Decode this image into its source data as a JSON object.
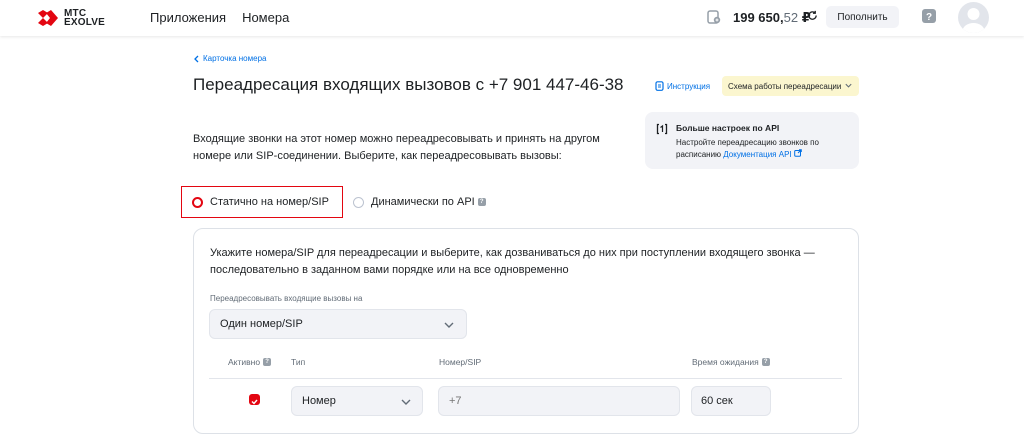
{
  "header": {
    "logo_line1": "МТС",
    "logo_line2": "EXOLVE",
    "nav": [
      "Приложения",
      "Номера"
    ],
    "balance_main": "199 650,",
    "balance_cents": "52",
    "currency": "₽",
    "topup_label": "Пополнить"
  },
  "breadcrumb": "Карточка номера",
  "title": "Переадресация входящих вызовов с +7 901 447-46-38",
  "instruction_link": "Инструкция",
  "scheme_button": "Схема работы переадресации",
  "description": "Входящие звонки на этот номер можно переадресовывать и принять на другом номере или SIP-соединении. Выберите, как переадресовывать вызовы:",
  "api_card": {
    "title": "Больше настроек по API",
    "text": "Настройте переадресацию звонков по расписанию",
    "link": "Документация API"
  },
  "modes": {
    "static": "Статично на номер/SIP",
    "dynamic": "Динамически по API"
  },
  "panel": {
    "description": "Укажите номера/SIP для переадресации и выберите, как дозваниваться до них при поступлении входящего звонка — последовательно в заданном вами порядке или на все одновременно",
    "forward_label": "Переадресовывать входящие вызовы на",
    "forward_value": "Один номер/SIP",
    "columns": {
      "active": "Активно",
      "type": "Тип",
      "number": "Номер/SIP",
      "wait": "Время ожидания"
    },
    "row": {
      "active": true,
      "type": "Номер",
      "number_placeholder": "+7",
      "wait": "60 сек"
    }
  },
  "colors": {
    "accent": "#e30611",
    "link": "#0070e5",
    "scheme_bg": "#fbf6cf"
  }
}
